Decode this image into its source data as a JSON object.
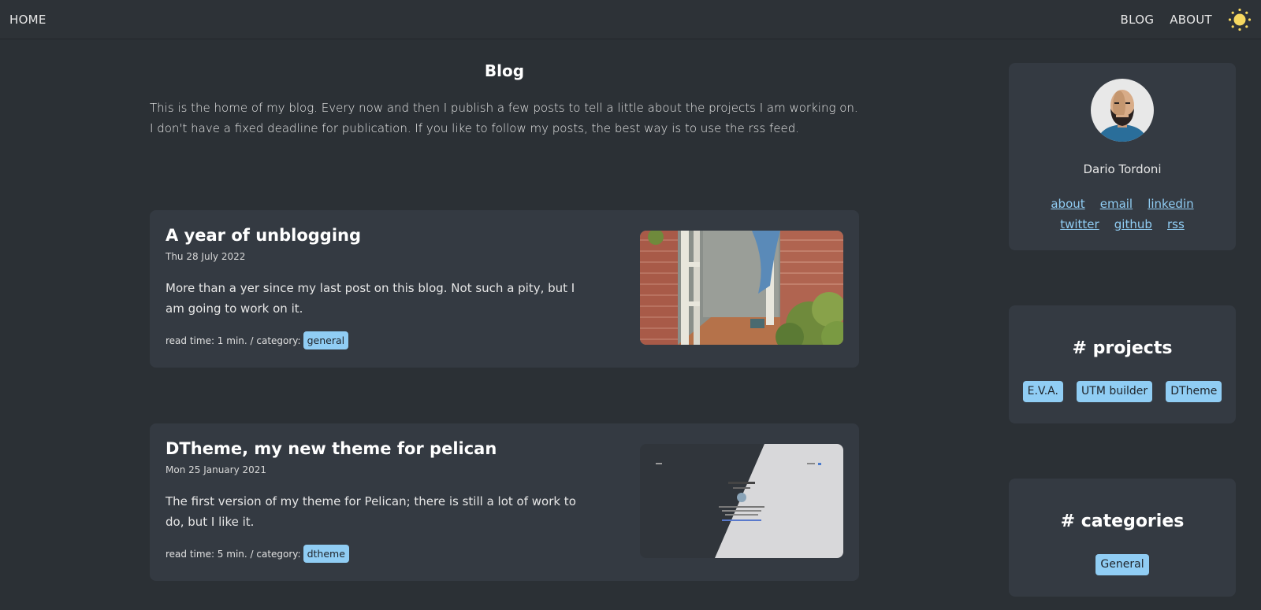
{
  "nav": {
    "home": "HOME",
    "blog": "BLOG",
    "about": "ABOUT",
    "theme_icon": "sun-icon"
  },
  "page": {
    "title": "Blog",
    "intro": "This is the home of my blog. Every now and then I publish a few posts to tell a little about the projects I am working on. I don't have a fixed deadline for publication. If you like to follow my posts, the best way is to use the rss feed."
  },
  "posts": [
    {
      "title": "A year of unblogging",
      "date": "Thu 28 July 2022",
      "excerpt": "More than a yer since my last post on this blog. Not such a pity, but I am going to work on it.",
      "meta": "read time: 1 min. / category:",
      "category": "general"
    },
    {
      "title": "DTheme, my new theme for pelican",
      "date": "Mon 25 January 2021",
      "excerpt": "The first version of my theme for Pelican; there is still a lot of work to do, but I like it.",
      "meta": "read time: 5 min. / category:",
      "category": "dtheme"
    }
  ],
  "sidebar": {
    "author": "Dario Tordoni",
    "links": [
      "about",
      "email",
      "linkedin",
      "twitter",
      "github",
      "rss"
    ],
    "projects_title": "# projects",
    "projects": [
      "E.V.A.",
      "UTM builder",
      "DTheme"
    ],
    "categories_title": "# categories",
    "categories": [
      "General"
    ]
  },
  "colors": {
    "background": "#2b3035",
    "card": "#343a42",
    "accent": "#90cdf4",
    "sun": "#f6d860"
  }
}
